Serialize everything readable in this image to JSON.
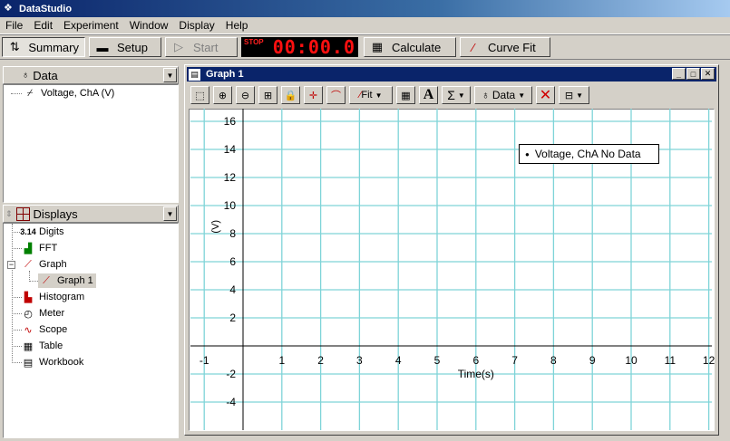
{
  "app": {
    "title": "DataStudio"
  },
  "menu": [
    "File",
    "Edit",
    "Experiment",
    "Window",
    "Display",
    "Help"
  ],
  "toolbar": {
    "summary": "Summary",
    "setup": "Setup",
    "start": "Start",
    "stop_label": "STOP",
    "clock": "00:00.0",
    "calculate": "Calculate",
    "curve_fit": "Curve Fit"
  },
  "data_panel": {
    "title": "Data",
    "items": [
      {
        "label": "Voltage, ChA (V)",
        "icon": "voltage-icon"
      }
    ]
  },
  "displays_panel": {
    "title": "Displays",
    "items": [
      {
        "label": "Digits",
        "icon": "digits-icon",
        "icon_text": "3.14"
      },
      {
        "label": "FFT",
        "icon": "fft-icon"
      },
      {
        "label": "Graph",
        "icon": "graph-icon"
      },
      {
        "label": "Graph 1",
        "icon": "graph-icon"
      },
      {
        "label": "Histogram",
        "icon": "histogram-icon"
      },
      {
        "label": "Meter",
        "icon": "meter-icon"
      },
      {
        "label": "Scope",
        "icon": "scope-icon"
      },
      {
        "label": "Table",
        "icon": "table-icon"
      },
      {
        "label": "Workbook",
        "icon": "workbook-icon"
      }
    ]
  },
  "graph_window": {
    "title": "Graph 1",
    "toolbar": {
      "fit": "Fit",
      "data": "Data",
      "sigma": "Σ",
      "text_tool": "A"
    }
  },
  "legend": {
    "text": "Voltage, ChA No Data"
  },
  "chart_data": {
    "type": "line",
    "title": "",
    "xlabel": "Time(s)",
    "ylabel": "(V)",
    "xlim": [
      -1.2,
      12.2
    ],
    "ylim": [
      -5.5,
      17
    ],
    "x_ticks": [
      -1,
      1,
      2,
      3,
      4,
      5,
      6,
      7,
      8,
      9,
      10,
      11,
      12
    ],
    "y_ticks": [
      -4,
      -2,
      2,
      4,
      6,
      8,
      10,
      12,
      14,
      16
    ],
    "grid": true,
    "legend": "top-right",
    "series": [
      {
        "name": "Voltage, ChA No Data",
        "x": [],
        "y": []
      }
    ],
    "colors": {
      "grid": "#7fd4d8",
      "axis": "#000000"
    }
  }
}
